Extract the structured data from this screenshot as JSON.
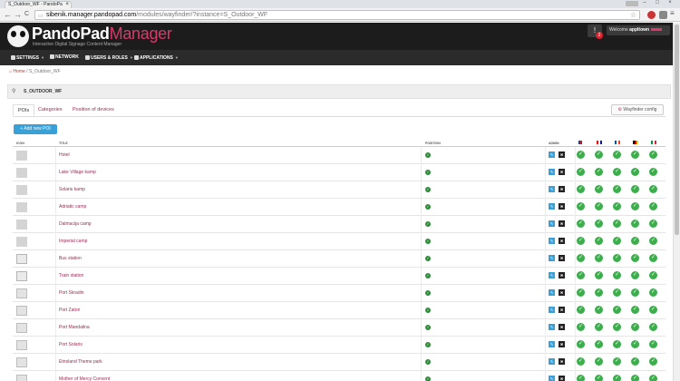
{
  "browser": {
    "tab_title": "S_Outdoor_WF - PandoPa",
    "tab_close": "×",
    "window_controls": [
      "–",
      "□",
      "×"
    ],
    "url_host": "sibenik.manager.pandopad.com",
    "url_rest": "/modules/wayfinder/?instance=S_Outdoor_WF",
    "nav": {
      "back": "←",
      "forward": "→",
      "reload": "C"
    }
  },
  "app": {
    "logo_main": "PandoPad",
    "logo_accent": "Manager",
    "logo_sub": "Interactive Digital Signage Content Manager",
    "alert_icon": "!",
    "alert_count": "2",
    "welcome_prefix": "Welcome",
    "welcome_user": "appltown"
  },
  "mainnav": {
    "items": [
      {
        "label": "SETTINGS",
        "caret": "▼"
      },
      {
        "label": "NETWORK",
        "caret": ""
      },
      {
        "label": "USERS & ROLES",
        "caret": "▼"
      },
      {
        "label": "APPLICATIONS",
        "caret": "▼"
      }
    ]
  },
  "breadcrumb": {
    "home": "Home",
    "sep": "/",
    "current": "S_Outdoor_WF"
  },
  "panel": {
    "title": "S_OUTDOOR_WF"
  },
  "tabs": [
    {
      "label": "POIs",
      "active": true
    },
    {
      "label": "Categories",
      "active": false
    },
    {
      "label": "Position of devices",
      "active": false
    }
  ],
  "wayfinder_config_label": "Wayfinder config",
  "add_button_label": "+ Add new POI",
  "table": {
    "headers": {
      "icon": "ICON",
      "title": "TITLE",
      "position": "POSITION",
      "admin": "ADMIN"
    },
    "language_flags": [
      {
        "lang": "en",
        "colors": [
          "#3c3b6e",
          "#b22234",
          "#ffffff"
        ]
      },
      {
        "lang": "hr",
        "colors": [
          "#ff0000",
          "#ffffff",
          "#171796"
        ]
      },
      {
        "lang": "fr",
        "colors": [
          "#0055a4",
          "#ffffff",
          "#ef4135"
        ]
      },
      {
        "lang": "de",
        "colors": [
          "#000000",
          "#dd0000",
          "#ffce00"
        ]
      },
      {
        "lang": "it",
        "colors": [
          "#009246",
          "#ffffff",
          "#ce2b37"
        ]
      }
    ],
    "check_glyph": "✓",
    "edit_glyph": "✎",
    "delete_glyph": "✖",
    "rows": [
      {
        "title": "Hotel"
      },
      {
        "title": "Lake Village kamp"
      },
      {
        "title": "Solaris kamp"
      },
      {
        "title": "Adriatic camp"
      },
      {
        "title": "Dalmacija camp"
      },
      {
        "title": "Imperial camp"
      },
      {
        "title": "Bus station"
      },
      {
        "title": "Train station"
      },
      {
        "title": "Port Skradin"
      },
      {
        "title": "Port Zaton"
      },
      {
        "title": "Port Mandalina"
      },
      {
        "title": "Port Solaris"
      },
      {
        "title": "Etnoland Theme park"
      },
      {
        "title": "Mother of Mercy Convent"
      }
    ]
  },
  "colors": {
    "accent": "#9b2a55",
    "primary_button": "#3aa0d8",
    "success": "#3cae4c",
    "header_bg": "#1c1c1c",
    "nav_bg": "#2b2b2b"
  }
}
